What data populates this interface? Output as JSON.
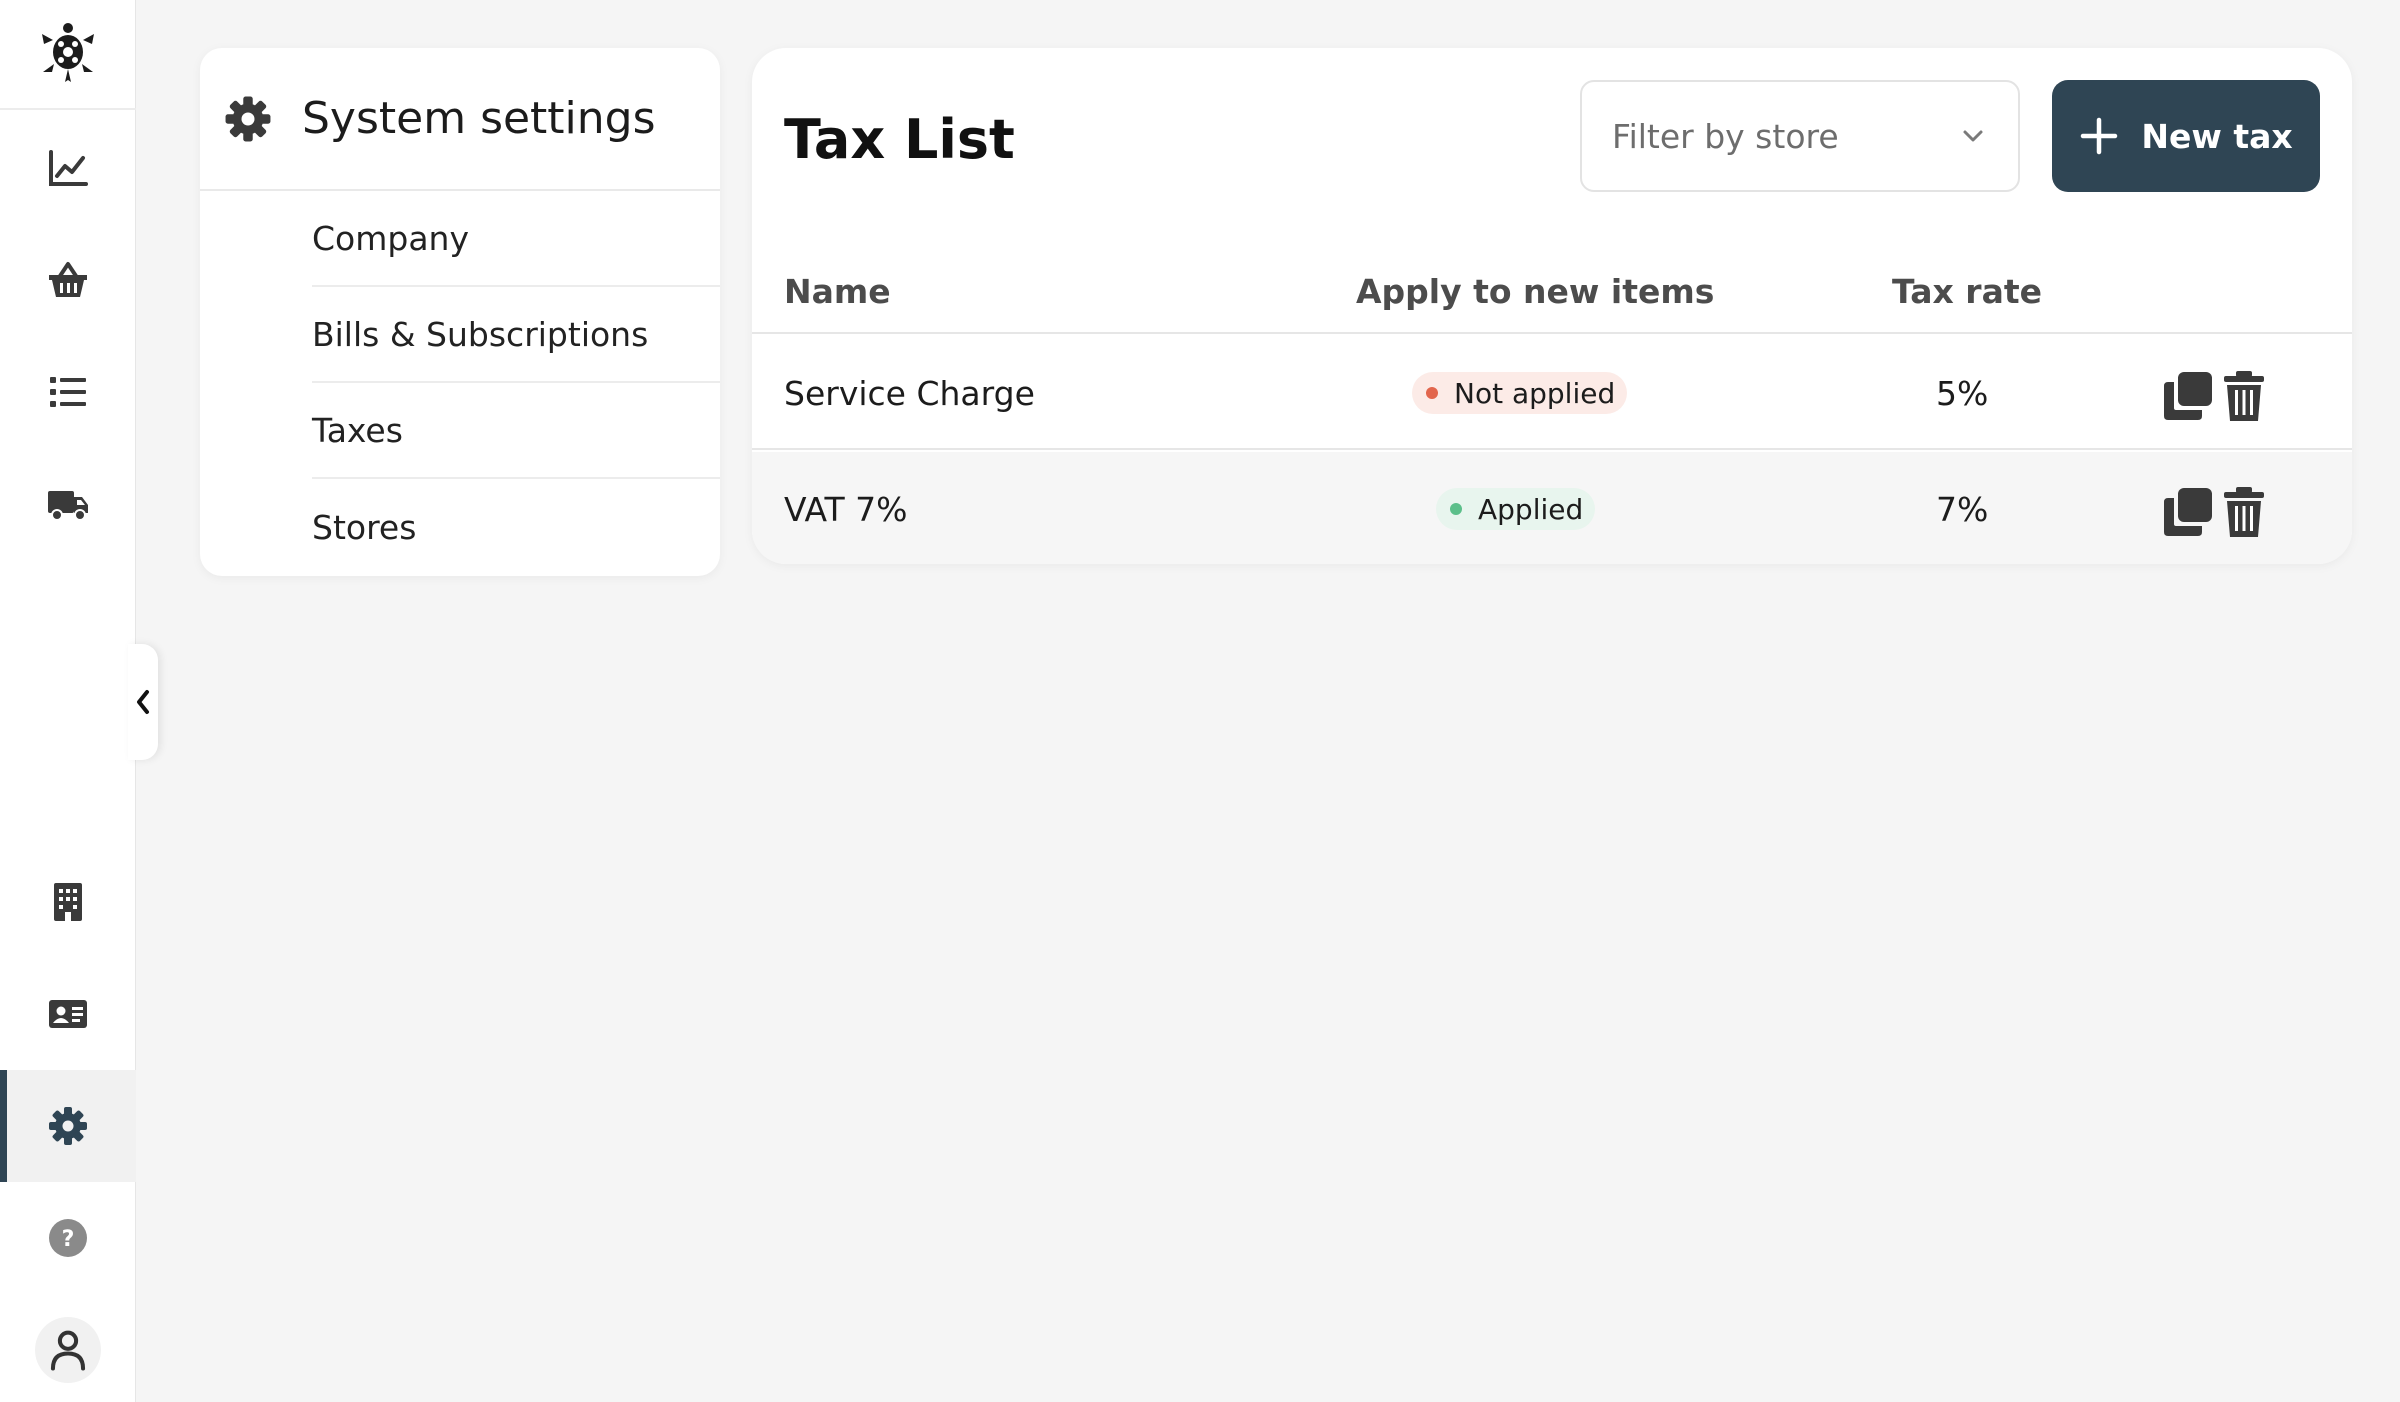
{
  "sidebar": {
    "logo_icon": "turtle-logo-icon",
    "items": [
      {
        "icon": "chart-line-icon",
        "active": false
      },
      {
        "icon": "basket-icon",
        "active": false
      },
      {
        "icon": "list-icon",
        "active": false
      },
      {
        "icon": "truck-icon",
        "active": false
      },
      {
        "icon": "building-icon",
        "active": false
      },
      {
        "icon": "id-card-icon",
        "active": false
      },
      {
        "icon": "gear-icon",
        "active": true
      },
      {
        "icon": "help-icon",
        "active": false
      },
      {
        "icon": "user-icon",
        "active": false
      }
    ],
    "collapse_icon": "chevron-left-icon"
  },
  "settings": {
    "title": "System settings",
    "nav": [
      "Company",
      "Bills & Subscriptions",
      "Taxes",
      "Stores"
    ]
  },
  "tax_list": {
    "title": "Tax List",
    "filter_placeholder": "Filter by store",
    "new_button_label": "New tax",
    "columns": [
      "Name",
      "Apply to new items",
      "Tax rate"
    ],
    "rows": [
      {
        "name": "Service Charge",
        "status": "Not applied",
        "rate": "5%"
      },
      {
        "name": "VAT 7%",
        "status": "Applied",
        "rate": "7%"
      }
    ]
  },
  "colors": {
    "primary": "#2f4554",
    "background": "#f5f5f5",
    "not_applied_dot": "#e2664d",
    "applied_dot": "#5cbf8a"
  }
}
